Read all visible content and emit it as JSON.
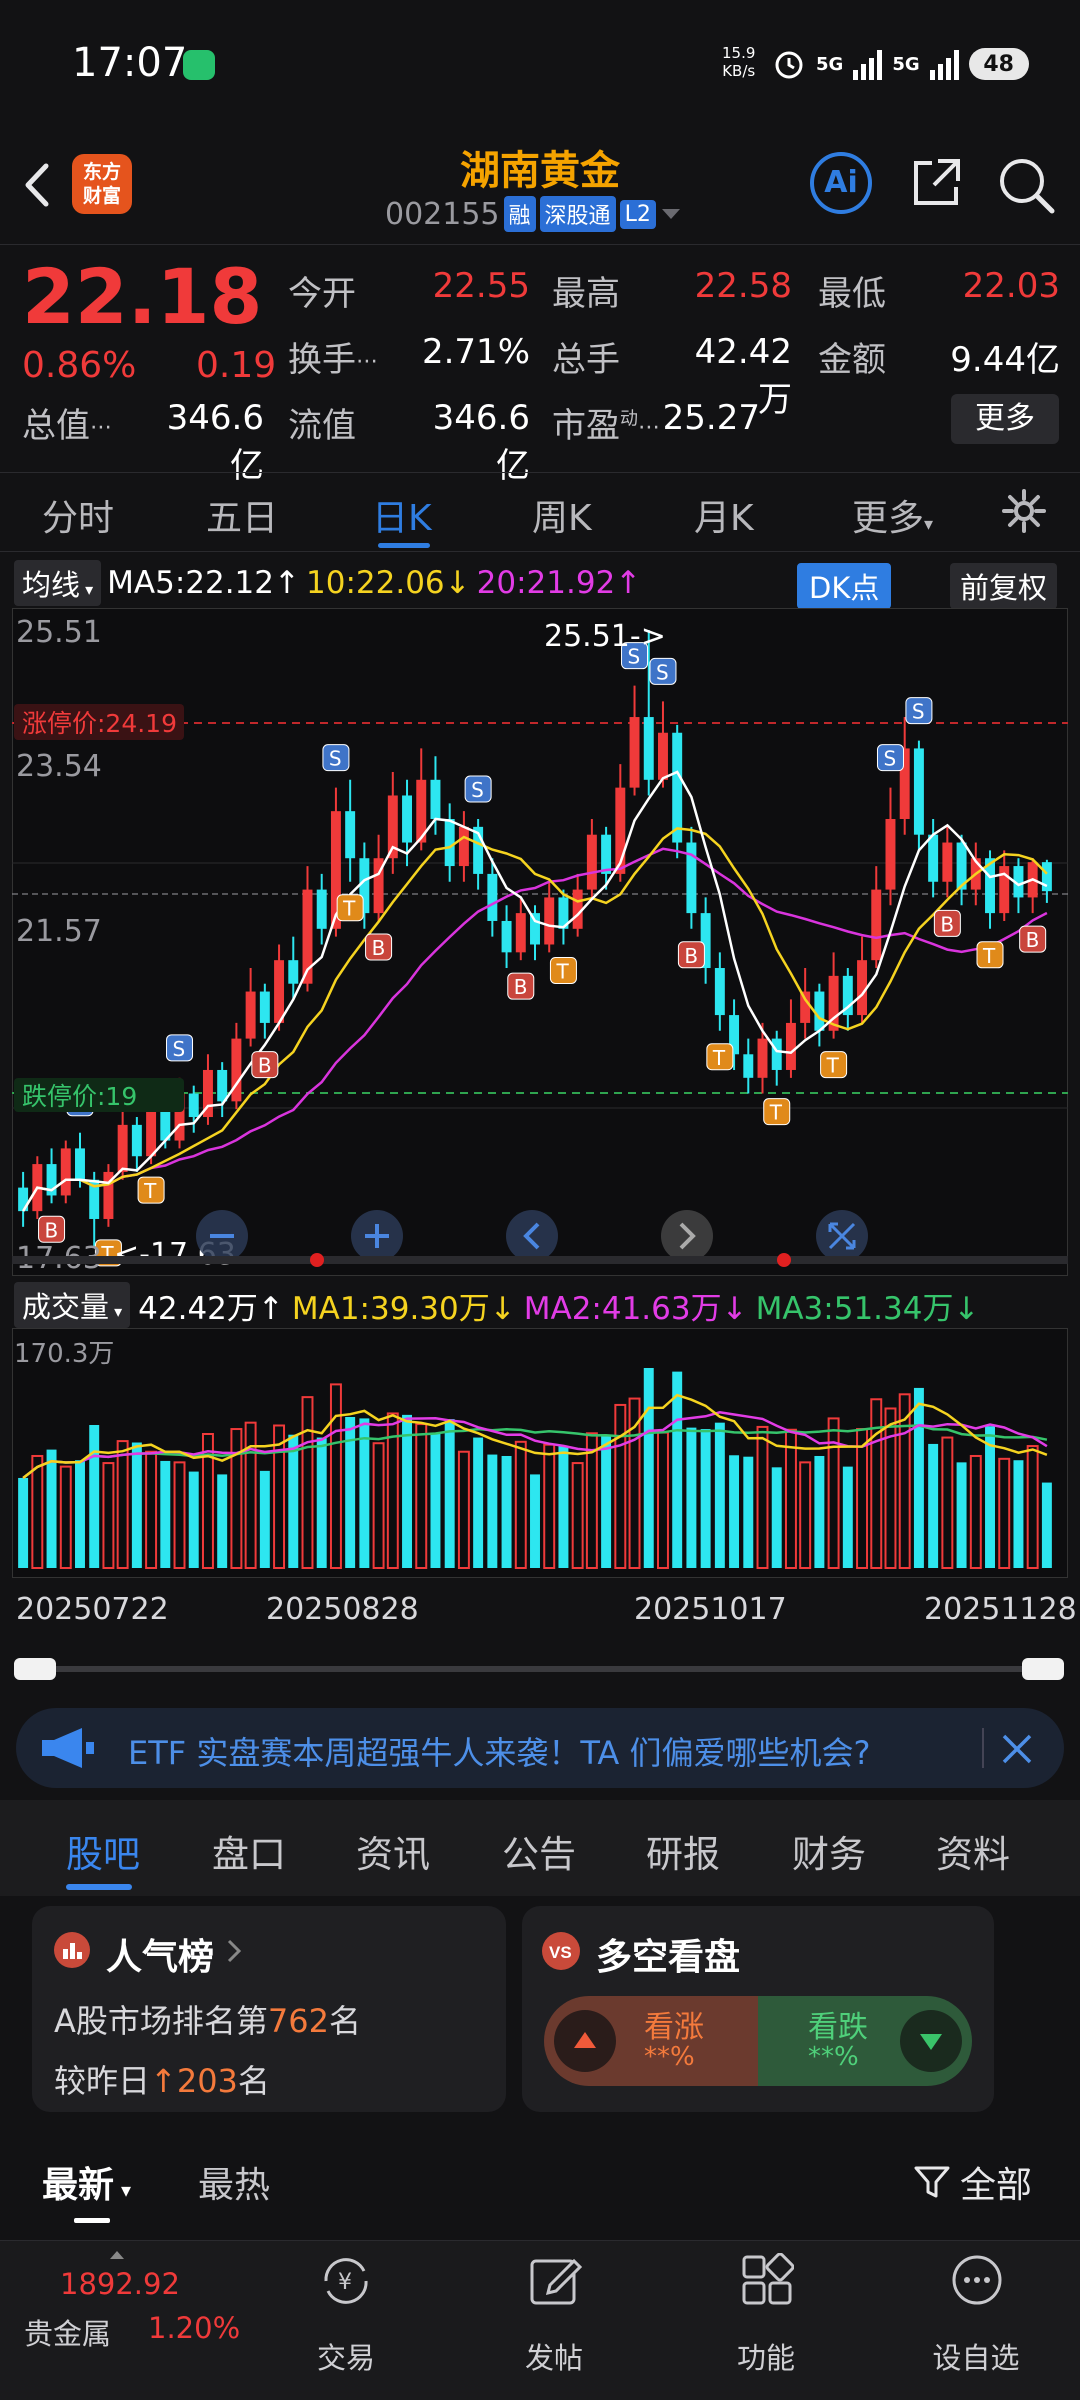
{
  "status_bar": {
    "time": "17:07",
    "net_speed": "15.9",
    "net_unit": "KB/s",
    "sim1": "5G",
    "sim2": "5G",
    "battery": "48"
  },
  "header": {
    "broker_logo_line1": "东方",
    "broker_logo_line2": "财富",
    "stock_name": "湖南黄金",
    "stock_code": "002155",
    "tags": [
      "融",
      "深股通",
      "L2"
    ],
    "ai_label": "Ai"
  },
  "quote": {
    "price": "22.18",
    "change_pct": "0.86%",
    "change": "0.19",
    "open_label": "今开",
    "open": "22.55",
    "high_label": "最高",
    "high": "22.58",
    "low_label": "最低",
    "low": "22.03",
    "turnover_label": "换手",
    "turnover": "2.71%",
    "volume_label": "总手",
    "volume": "42.42万",
    "amount_label": "金额",
    "amount": "9.44亿",
    "mktcap_label": "总值",
    "mktcap": "346.6亿",
    "float_label": "流值",
    "float_cap": "346.6亿",
    "pe_label": "市盈",
    "pe_sup": "动",
    "pe": "25.27",
    "more_button": "更多"
  },
  "chart_tabs": [
    "分时",
    "五日",
    "日K",
    "周K",
    "月K",
    "更多"
  ],
  "active_chart_tab": "日K",
  "ma_row": {
    "selector": "均线",
    "ma5": "MA5:22.12",
    "ma10": "10:22.06",
    "ma20": "20:21.92",
    "dk_button": "DK点",
    "adjust_button": "前复权"
  },
  "kline_labels": {
    "y_top": "25.51",
    "y_mid1": "23.54",
    "y_mid2": "21.57",
    "y_bottom": "17.63",
    "limit_up": "涨停价:24.19",
    "high_marker": "25.51->",
    "low_marker": "<-17.63",
    "limit_down_partial": "跌停价:19"
  },
  "volume_row": {
    "selector": "成交量",
    "vol": "42.42万",
    "ma1": "MA1:39.30万",
    "ma2": "MA2:41.63万",
    "ma3": "MA3:51.34万",
    "vmax": "170.3万"
  },
  "dates": [
    "20250722",
    "20250828",
    "20251017",
    "20251128"
  ],
  "banner": {
    "text": "ETF 实盘赛本周超强牛人来袭！TA 们偏爱哪些机会?"
  },
  "sub_tabs": [
    "股吧",
    "盘口",
    "资讯",
    "公告",
    "研报",
    "财务",
    "资料"
  ],
  "active_sub_tab": "股吧",
  "popularity_card": {
    "title": "人气榜",
    "line1_prefix": "A股市场排名第",
    "rank": "762",
    "line1_suffix": "名",
    "line2_prefix": "较昨日",
    "rank_change": "203",
    "line2_suffix": "名"
  },
  "bullbear_card": {
    "title": "多空看盘",
    "bull_label": "看涨",
    "bull_value": "**%",
    "bear_label": "看跌",
    "bear_value": "**%"
  },
  "feed": {
    "latest": "最新",
    "hottest": "最热",
    "filter": "全部"
  },
  "bottom_nav": {
    "ticker_value": "1892.92",
    "ticker_name": "贵金属",
    "ticker_change": "1.20%",
    "items": [
      "交易",
      "发帖",
      "功能",
      "设自选"
    ]
  },
  "colors": {
    "up": "#f03a3a",
    "down": "#2de6f0",
    "accent": "#2f7de1",
    "ma5": "#ffffff",
    "ma10": "#f5d320",
    "ma20": "#e23ce6"
  },
  "chart_data": {
    "type": "candlestick",
    "y_axis_labels": [
      "25.51",
      "23.54",
      "21.57",
      "17.63"
    ],
    "period_high": 25.51,
    "period_low": 17.63,
    "limit_up_price": 24.19,
    "last_close": 22.18,
    "x_axis_labels": [
      "20250722",
      "20250828",
      "20251017",
      "20251128"
    ],
    "ma_values": {
      "MA5": 22.12,
      "MA10": 22.06,
      "MA20": 21.92
    },
    "candles": [
      [
        18.4,
        18.1,
        18.6,
        17.9
      ],
      [
        18.1,
        18.7,
        18.8,
        18.0
      ],
      [
        18.7,
        18.3,
        18.9,
        18.2
      ],
      [
        18.3,
        18.9,
        19.0,
        18.2
      ],
      [
        18.9,
        18.5,
        19.1,
        18.4
      ],
      [
        18.5,
        18.0,
        18.6,
        17.63
      ],
      [
        18.0,
        18.6,
        18.7,
        17.9
      ],
      [
        18.6,
        19.2,
        19.4,
        18.5
      ],
      [
        19.2,
        18.8,
        19.3,
        18.6
      ],
      [
        18.8,
        19.4,
        19.6,
        18.7
      ],
      [
        19.4,
        19.0,
        19.5,
        18.9
      ],
      [
        19.0,
        19.6,
        19.8,
        18.9
      ],
      [
        19.6,
        19.3,
        19.7,
        19.1
      ],
      [
        19.3,
        19.9,
        20.1,
        19.2
      ],
      [
        19.9,
        19.5,
        20.0,
        19.3
      ],
      [
        19.5,
        20.3,
        20.5,
        19.4
      ],
      [
        20.3,
        20.9,
        21.2,
        20.2
      ],
      [
        20.9,
        20.5,
        21.0,
        20.3
      ],
      [
        20.5,
        21.3,
        21.5,
        20.4
      ],
      [
        21.3,
        21.0,
        21.6,
        20.8
      ],
      [
        21.0,
        22.2,
        22.5,
        20.9
      ],
      [
        22.2,
        21.7,
        22.4,
        21.5
      ],
      [
        21.7,
        23.2,
        23.5,
        21.6
      ],
      [
        23.2,
        22.6,
        23.6,
        22.3
      ],
      [
        22.6,
        21.9,
        22.8,
        21.7
      ],
      [
        21.9,
        22.6,
        22.9,
        21.8
      ],
      [
        22.6,
        23.4,
        23.7,
        22.4
      ],
      [
        23.4,
        22.8,
        23.6,
        22.5
      ],
      [
        22.8,
        23.6,
        24.0,
        22.7
      ],
      [
        23.6,
        23.1,
        23.9,
        22.9
      ],
      [
        23.1,
        22.5,
        23.3,
        22.3
      ],
      [
        22.5,
        23.0,
        23.2,
        22.3
      ],
      [
        23.0,
        22.4,
        23.1,
        22.2
      ],
      [
        22.4,
        21.8,
        22.6,
        21.6
      ],
      [
        21.8,
        21.4,
        22.0,
        21.2
      ],
      [
        21.4,
        21.9,
        22.1,
        21.3
      ],
      [
        21.9,
        21.5,
        22.0,
        21.3
      ],
      [
        21.5,
        22.1,
        22.3,
        21.4
      ],
      [
        22.1,
        21.7,
        22.2,
        21.5
      ],
      [
        21.7,
        22.2,
        22.4,
        21.6
      ],
      [
        22.2,
        22.9,
        23.1,
        22.1
      ],
      [
        22.9,
        22.4,
        23.0,
        22.2
      ],
      [
        22.4,
        23.5,
        23.8,
        22.3
      ],
      [
        23.5,
        24.4,
        24.8,
        23.4
      ],
      [
        24.4,
        23.6,
        25.51,
        23.4
      ],
      [
        23.6,
        24.2,
        24.6,
        23.5
      ],
      [
        24.2,
        22.8,
        24.3,
        22.6
      ],
      [
        22.8,
        21.9,
        23.0,
        21.7
      ],
      [
        21.9,
        21.2,
        22.1,
        21.0
      ],
      [
        21.2,
        20.6,
        21.4,
        20.4
      ],
      [
        20.6,
        20.1,
        20.8,
        19.9
      ],
      [
        20.1,
        19.8,
        20.3,
        19.6
      ],
      [
        19.8,
        20.3,
        20.5,
        19.6
      ],
      [
        20.3,
        19.9,
        20.4,
        19.7
      ],
      [
        19.9,
        20.5,
        20.8,
        19.8
      ],
      [
        20.5,
        20.9,
        21.2,
        20.3
      ],
      [
        20.9,
        20.4,
        21.0,
        20.2
      ],
      [
        20.4,
        21.1,
        21.4,
        20.3
      ],
      [
        21.1,
        20.6,
        21.2,
        20.4
      ],
      [
        20.6,
        21.3,
        21.6,
        20.5
      ],
      [
        21.3,
        22.2,
        22.5,
        21.2
      ],
      [
        22.2,
        23.1,
        23.5,
        22.0
      ],
      [
        23.1,
        24.0,
        24.4,
        22.9
      ],
      [
        24.0,
        22.9,
        24.1,
        22.7
      ],
      [
        22.9,
        22.3,
        23.1,
        22.1
      ],
      [
        22.3,
        22.8,
        23.0,
        22.1
      ],
      [
        22.8,
        22.2,
        22.9,
        22.0
      ],
      [
        22.2,
        22.6,
        22.8,
        22.0
      ],
      [
        22.6,
        21.9,
        22.7,
        21.7
      ],
      [
        21.9,
        22.5,
        22.7,
        21.8
      ],
      [
        22.5,
        22.1,
        22.6,
        21.9
      ],
      [
        22.1,
        22.55,
        22.6,
        21.9
      ],
      [
        22.55,
        22.18,
        22.58,
        22.03
      ]
    ],
    "volume": {
      "max_label": "170.3万",
      "last": "42.42万",
      "MA1": "39.30万",
      "MA2": "41.63万",
      "MA3": "51.34万"
    }
  }
}
